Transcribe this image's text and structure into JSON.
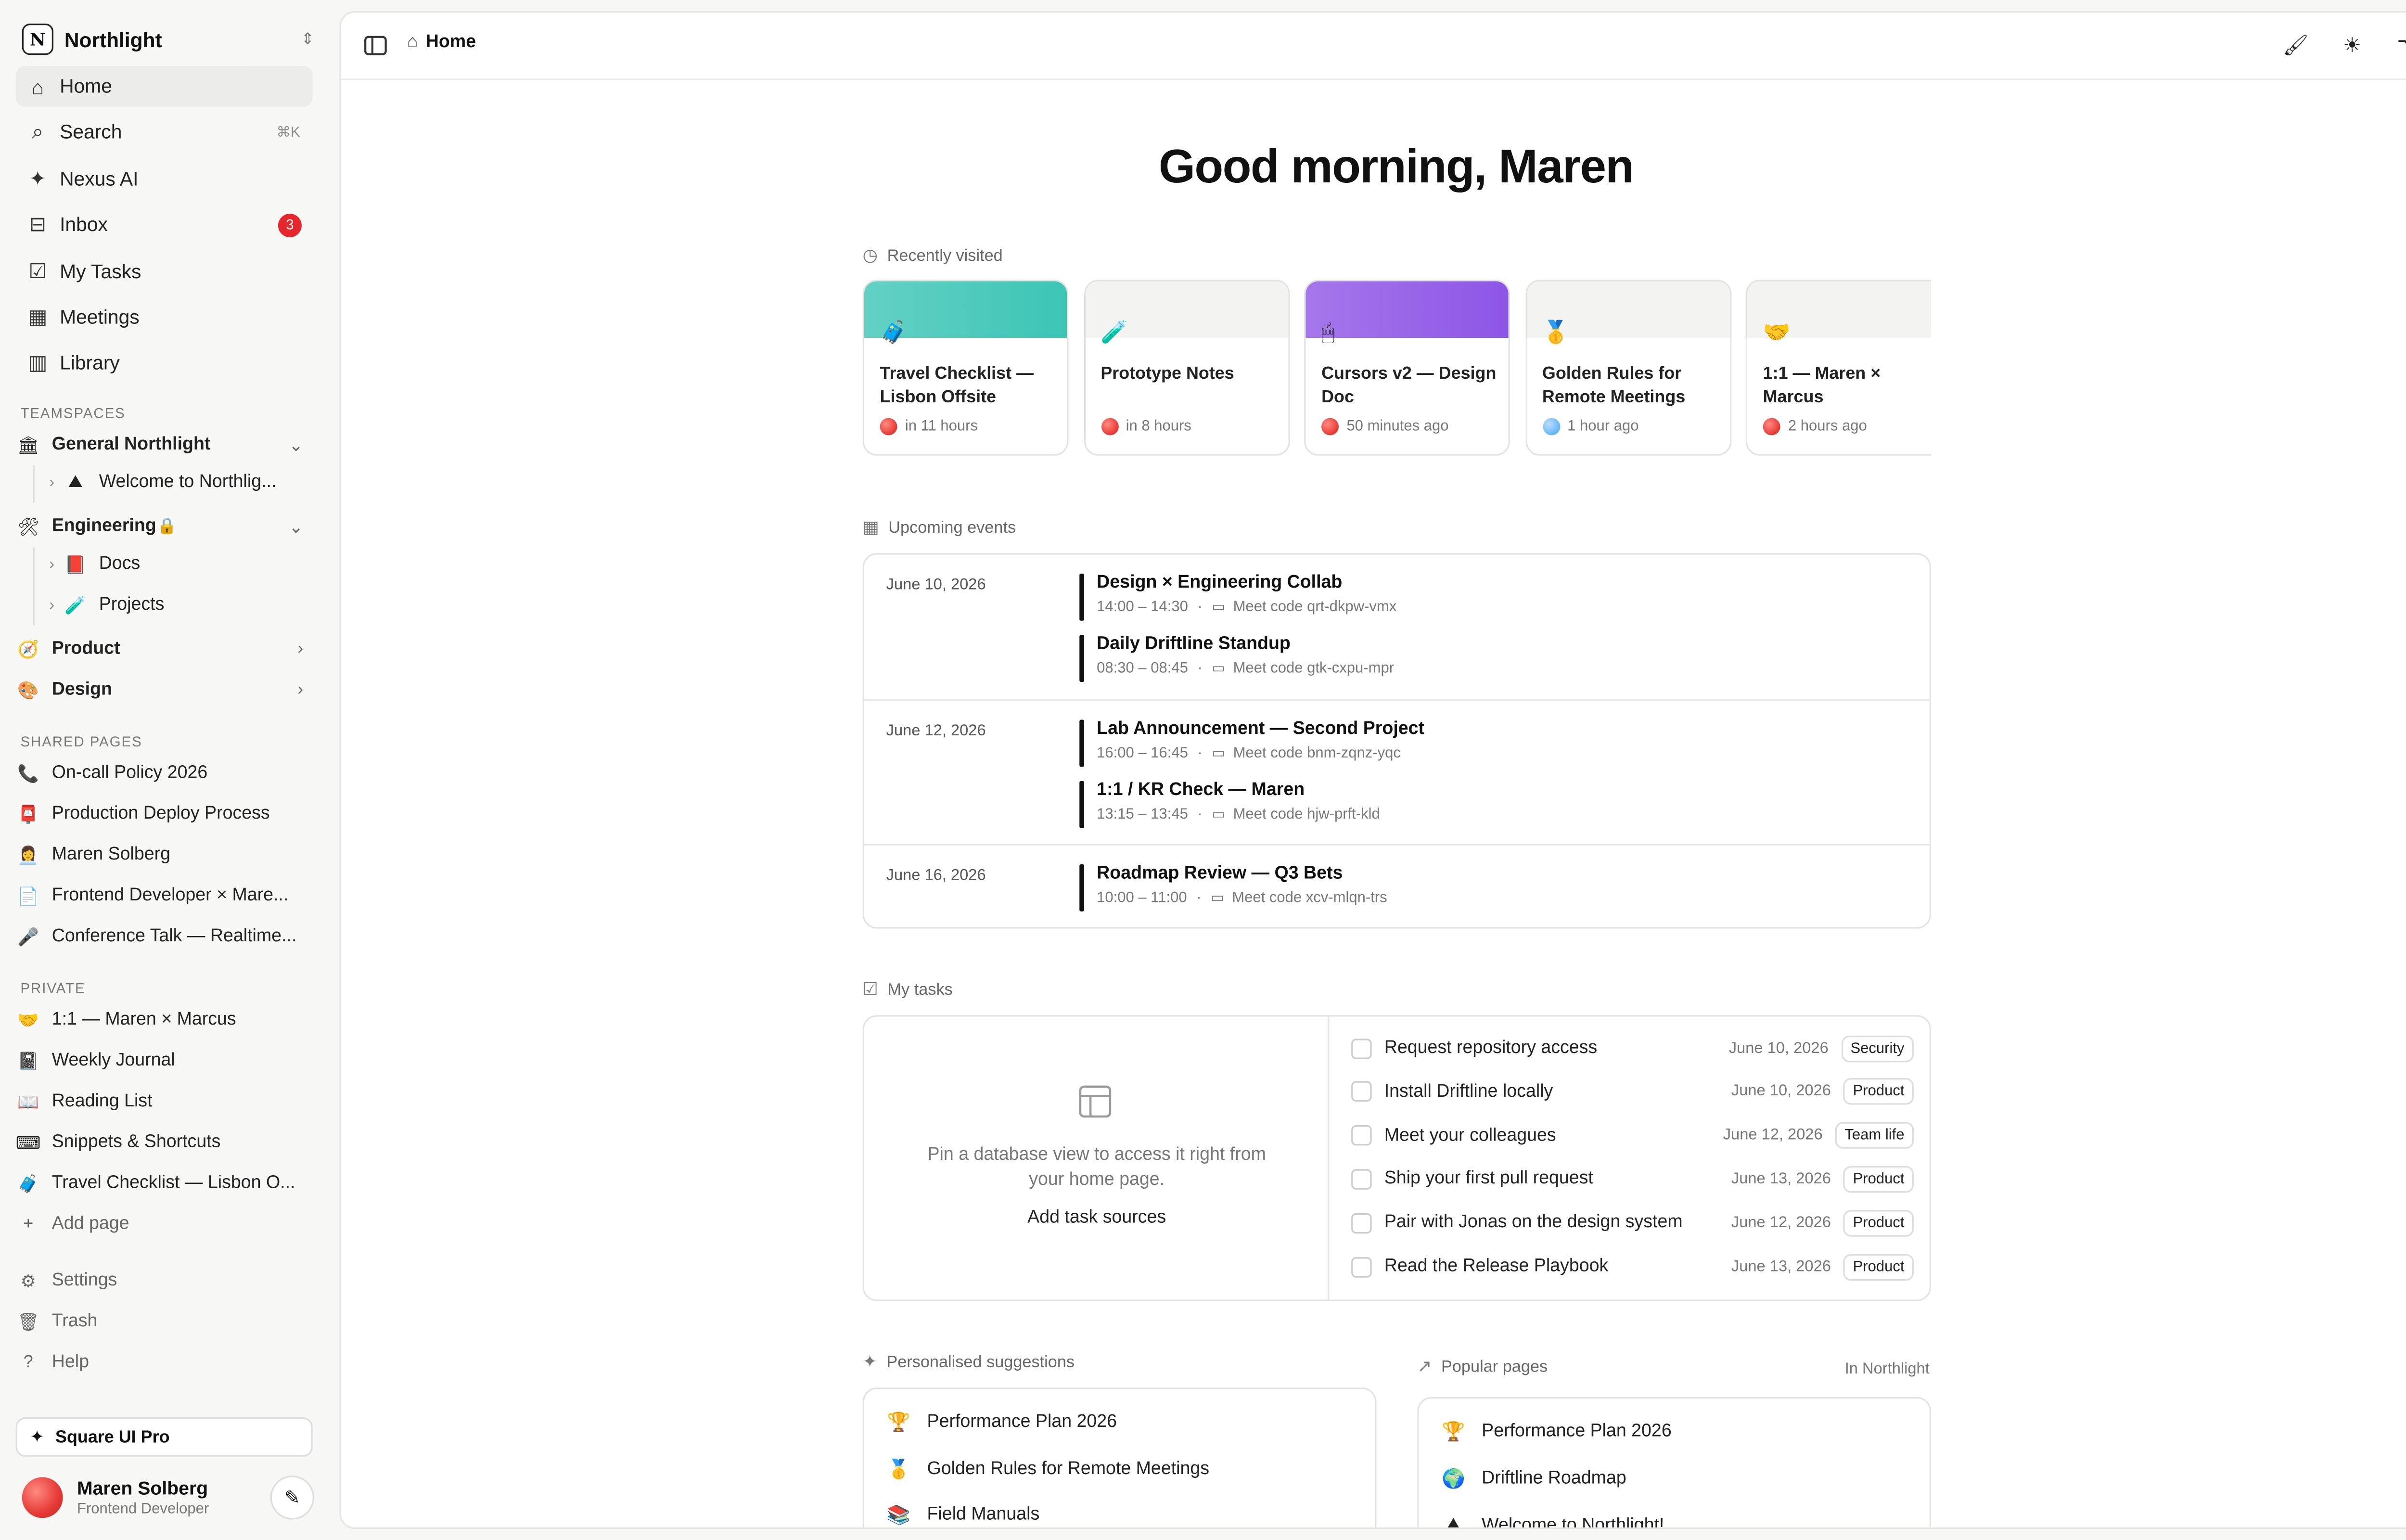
{
  "workspace": {
    "logo": "N",
    "name": "Northlight"
  },
  "nav": [
    {
      "icon": "home-icon",
      "glyph": "⌂",
      "label": "Home",
      "active": true
    },
    {
      "icon": "search-icon",
      "glyph": "⌕",
      "label": "Search",
      "kbd": "⌘K"
    },
    {
      "icon": "sparkle-icon",
      "glyph": "✦",
      "label": "Nexus AI"
    },
    {
      "icon": "inbox-icon",
      "glyph": "⊟",
      "label": "Inbox",
      "badge": "3"
    },
    {
      "icon": "checkbox-icon",
      "glyph": "☑",
      "label": "My Tasks"
    },
    {
      "icon": "calendar-icon",
      "glyph": "▦",
      "label": "Meetings"
    },
    {
      "icon": "library-icon",
      "glyph": "▥",
      "label": "Library"
    }
  ],
  "teamspaces": {
    "label": "TEAMSPACES",
    "items": [
      {
        "emoji": "🏛",
        "label": "General Northlight",
        "chev": "⌄"
      },
      {
        "emoji": "⛰",
        "label": "Welcome to Northlig...",
        "sub": true
      },
      {
        "emoji": "🛠",
        "label": "Engineering",
        "chev": "⌄",
        "lock": "🔒"
      },
      {
        "emoji": "📕",
        "label": "Docs",
        "sub": true
      },
      {
        "emoji": "🧪",
        "label": "Projects",
        "sub": true
      },
      {
        "emoji": "🧭",
        "label": "Product",
        "chev": "›"
      },
      {
        "emoji": "🎨",
        "label": "Design",
        "chev": "›"
      }
    ]
  },
  "shared": {
    "label": "SHARED PAGES",
    "items": [
      {
        "emoji": "📞",
        "label": "On-call Policy 2026"
      },
      {
        "emoji": "📮",
        "label": "Production Deploy Process"
      },
      {
        "emoji": "👩‍💼",
        "label": "Maren Solberg"
      },
      {
        "emoji": "📄",
        "label": "Frontend Developer × Mare..."
      },
      {
        "emoji": "🎤",
        "label": "Conference Talk — Realtime..."
      }
    ]
  },
  "private": {
    "label": "PRIVATE",
    "items": [
      {
        "emoji": "🤝",
        "label": "1:1 — Maren × Marcus"
      },
      {
        "emoji": "📓",
        "label": "Weekly Journal"
      },
      {
        "emoji": "📖",
        "label": "Reading List"
      },
      {
        "emoji": "⌨",
        "label": "Snippets & Shortcuts"
      },
      {
        "emoji": "🧳",
        "label": "Travel Checklist — Lisbon O..."
      }
    ],
    "add_page": "Add page"
  },
  "footer_nav": [
    {
      "glyph": "⚙",
      "label": "Settings",
      "icon": "gear-icon"
    },
    {
      "glyph": "🗑",
      "label": "Trash",
      "icon": "trash-icon"
    },
    {
      "glyph": "?",
      "label": "Help",
      "icon": "help-icon"
    }
  ],
  "pro_button": "Square UI Pro",
  "user": {
    "name": "Maren Solberg",
    "role": "Frontend Developer"
  },
  "breadcrumb": "Home",
  "greeting": "Good morning, Maren",
  "recent": {
    "label": "Recently visited",
    "cards": [
      {
        "emoji": "🧳",
        "title": "Travel Checklist — Lisbon Offsite",
        "time": "in 11 hours",
        "cover": "#3cc5b5",
        "dot": "red"
      },
      {
        "emoji": "🧪",
        "title": "Prototype Notes",
        "time": "in 8 hours",
        "cover": "",
        "dot": "red"
      },
      {
        "emoji": "🖱",
        "title": "Cursors v2 — Design Doc",
        "time": "50 minutes ago",
        "cover": "#8e55e6",
        "dot": "red"
      },
      {
        "emoji": "🥇",
        "title": "Golden Rules for Remote Meetings",
        "time": "1 hour ago",
        "cover": "",
        "dot": "blue"
      },
      {
        "emoji": "🤝",
        "title": "1:1 — Maren × Marcus",
        "time": "2 hours ago",
        "cover": "",
        "dot": "red"
      }
    ]
  },
  "events": {
    "label": "Upcoming events",
    "groups": [
      {
        "date": "June 10, 2026",
        "items": [
          {
            "title": "Design × Engineering Collab",
            "time": "14:00 – 14:30",
            "meet": "Meet code qrt-dkpw-vmx"
          },
          {
            "title": "Daily Driftline Standup",
            "time": "08:30 – 08:45",
            "meet": "Meet code gtk-cxpu-mpr"
          }
        ]
      },
      {
        "date": "June 12, 2026",
        "items": [
          {
            "title": "Lab Announcement — Second Project",
            "time": "16:00 – 16:45",
            "meet": "Meet code bnm-zqnz-yqc"
          },
          {
            "title": "1:1 / KR Check — Maren",
            "time": "13:15 – 13:45",
            "meet": "Meet code hjw-prft-kld"
          }
        ]
      },
      {
        "date": "June 16, 2026",
        "items": [
          {
            "title": "Roadmap Review — Q3 Bets",
            "time": "10:00 – 11:00",
            "meet": "Meet code xcv-mlqn-trs"
          }
        ]
      }
    ]
  },
  "tasks": {
    "label": "My tasks",
    "pin_text": "Pin a database view to access it right from your home page.",
    "add_sources": "Add task sources",
    "items": [
      {
        "name": "Request repository access",
        "date": "June 10, 2026",
        "tag": "Security"
      },
      {
        "name": "Install Driftline locally",
        "date": "June 10, 2026",
        "tag": "Product"
      },
      {
        "name": "Meet your colleagues",
        "date": "June 12, 2026",
        "tag": "Team life"
      },
      {
        "name": "Ship your first pull request",
        "date": "June 13, 2026",
        "tag": "Product"
      },
      {
        "name": "Pair with Jonas on the design system",
        "date": "June 12, 2026",
        "tag": "Product"
      },
      {
        "name": "Read the Release Playbook",
        "date": "June 13, 2026",
        "tag": "Product"
      }
    ]
  },
  "suggestions": {
    "label": "Personalised suggestions",
    "items": [
      {
        "emoji": "🏆",
        "label": "Performance Plan 2026"
      },
      {
        "emoji": "🥇",
        "label": "Golden Rules for Remote Meetings"
      },
      {
        "emoji": "📚",
        "label": "Field Manuals"
      }
    ]
  },
  "popular": {
    "label": "Popular pages",
    "scope": "In Northlight",
    "items": [
      {
        "emoji": "🏆",
        "label": "Performance Plan 2026"
      },
      {
        "emoji": "🌍",
        "label": "Driftline Roadmap"
      },
      {
        "emoji": "⛰",
        "label": "Welcome to Northlight!"
      }
    ]
  }
}
